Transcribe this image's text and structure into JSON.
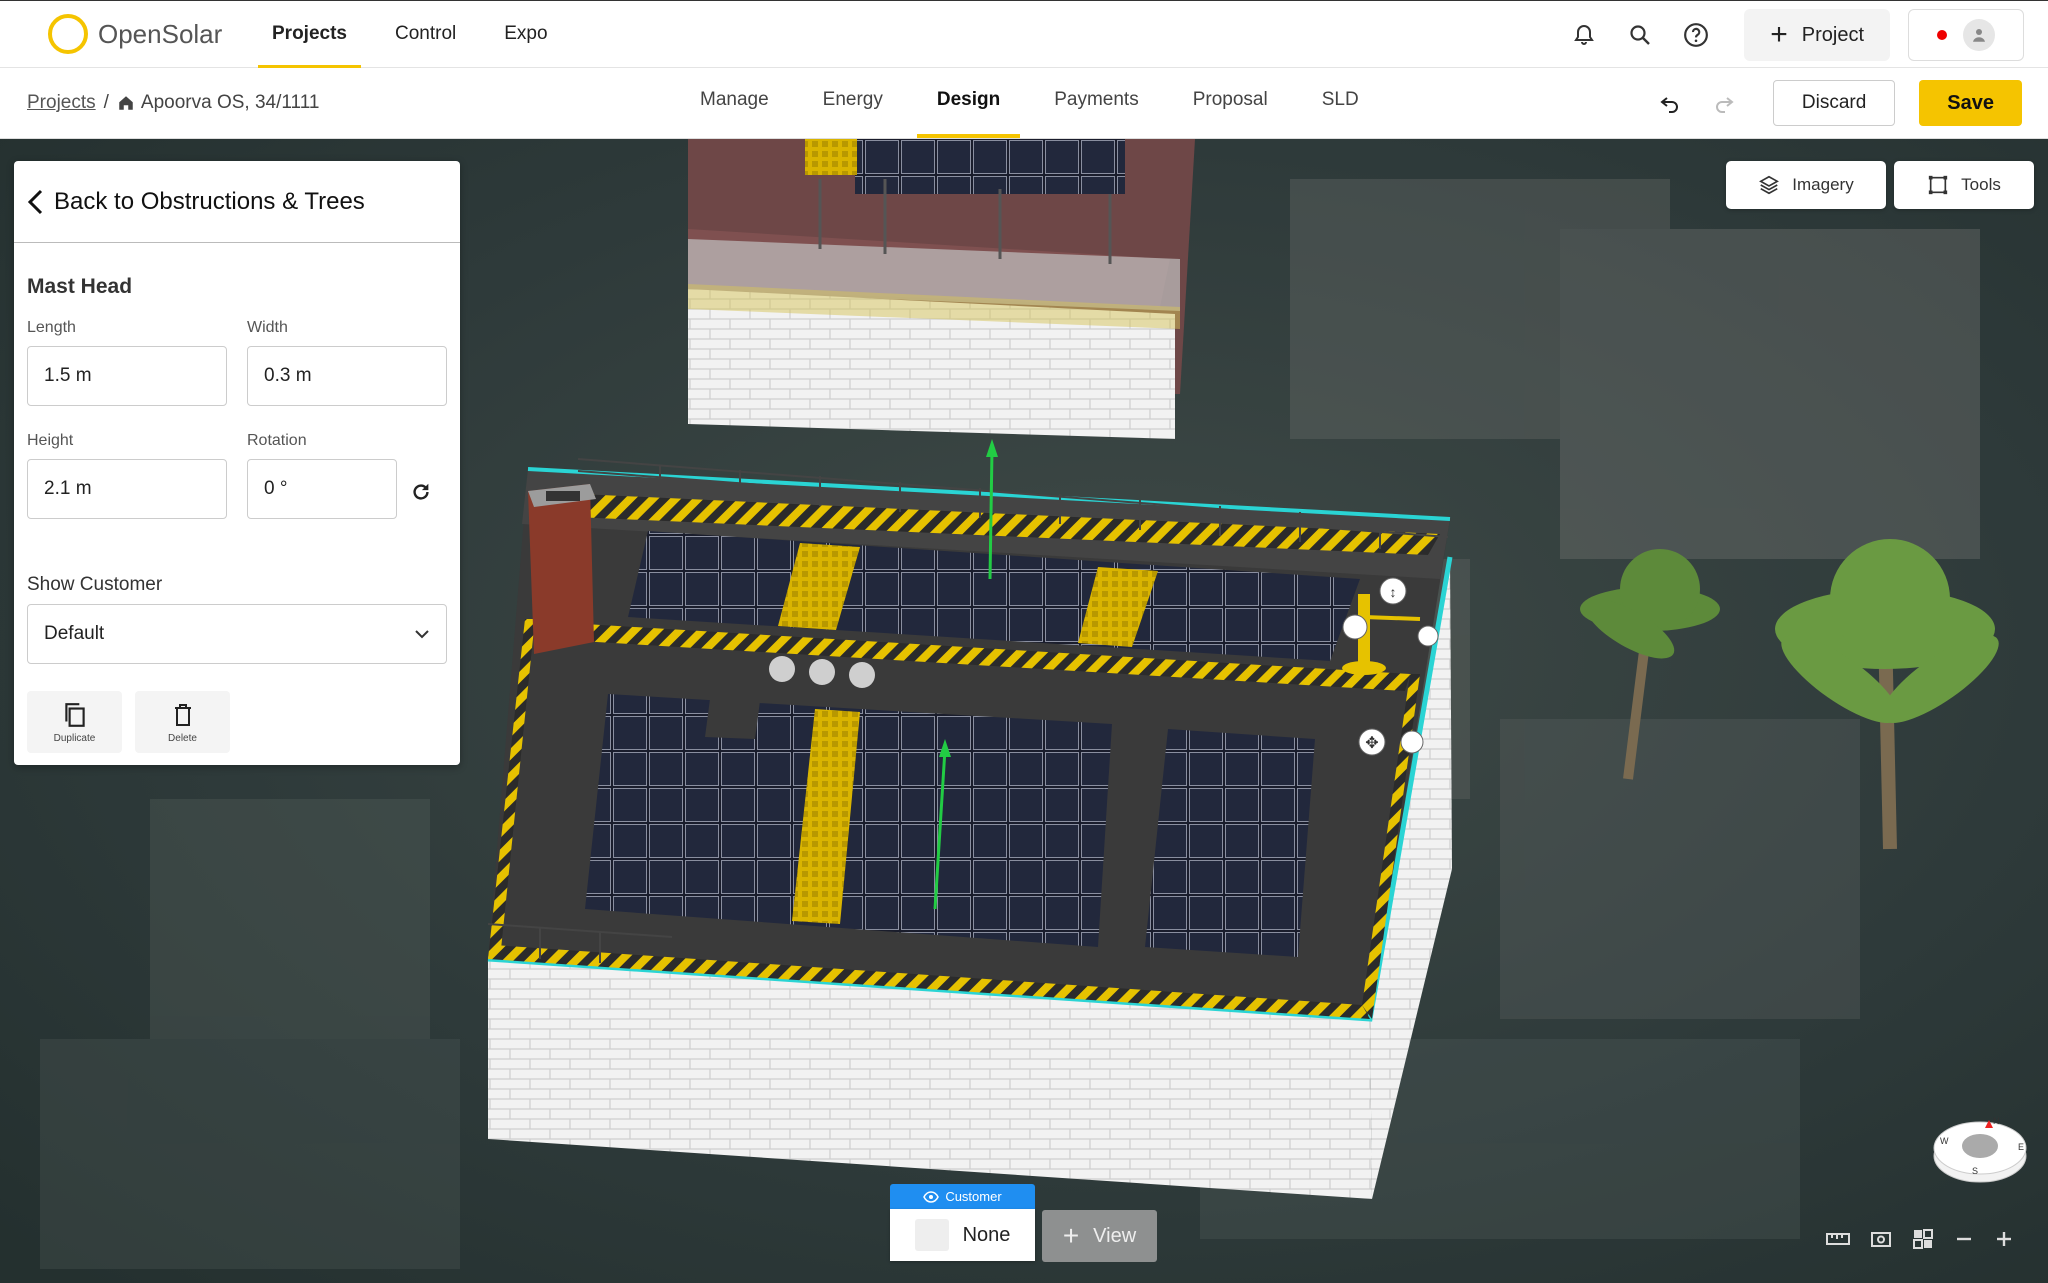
{
  "app": {
    "brand": "OpenSolar",
    "brand_color": "#f5c400"
  },
  "topnav": {
    "items": [
      {
        "label": "Projects",
        "active": true
      },
      {
        "label": "Control"
      },
      {
        "label": "Expo"
      }
    ]
  },
  "topicons": {
    "notification": "bell-icon",
    "search": "search-icon",
    "help": "help-icon"
  },
  "project_button": {
    "label": "Project",
    "icon": "plus-icon"
  },
  "breadcrumb": {
    "root": "Projects",
    "current": "Apoorva OS, 34/1111"
  },
  "tabs": [
    {
      "label": "Manage"
    },
    {
      "label": "Energy"
    },
    {
      "label": "Design",
      "active": true
    },
    {
      "label": "Payments"
    },
    {
      "label": "Proposal"
    },
    {
      "label": "SLD"
    }
  ],
  "actions": {
    "discard": "Discard",
    "save": "Save"
  },
  "panel": {
    "back_label": "Back to Obstructions & Trees",
    "section_title": "Mast Head",
    "fields": {
      "length": {
        "label": "Length",
        "value": "1.5 m"
      },
      "width": {
        "label": "Width",
        "value": "0.3 m"
      },
      "height": {
        "label": "Height",
        "value": "2.1 m"
      },
      "rotation": {
        "label": "Rotation",
        "value": "0 °"
      }
    },
    "show_customer": {
      "label": "Show Customer",
      "value": "Default"
    },
    "duplicate": "Duplicate",
    "delete": "Delete"
  },
  "map_controls": {
    "imagery": "Imagery",
    "tools": "Tools"
  },
  "view_selector": {
    "tag": "Customer",
    "current": "None",
    "add_label": "View"
  },
  "compass": {
    "n": "N",
    "e": "E",
    "s": "S",
    "w": "W"
  }
}
